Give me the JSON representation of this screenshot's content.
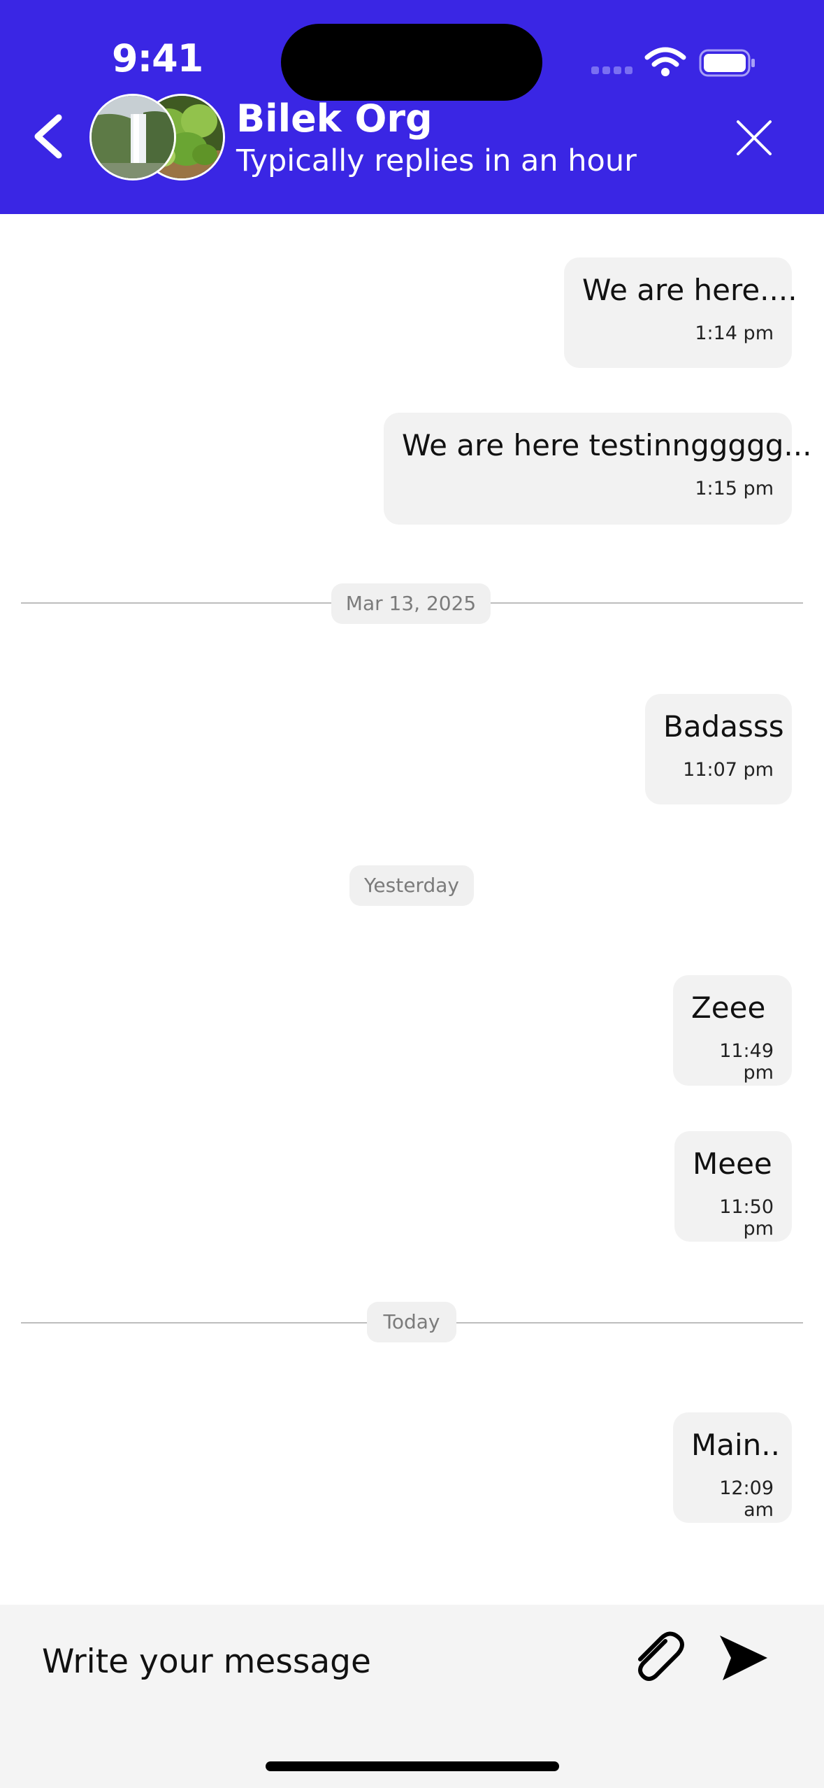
{
  "status_bar": {
    "time": "9:41"
  },
  "header": {
    "title": "Bilek Org",
    "subtitle": "Typically replies in an hour",
    "icons": {
      "back": "chevron-left-icon",
      "close": "close-icon"
    }
  },
  "messages": [
    {
      "text": "We are here....",
      "time": "1:14 pm"
    },
    {
      "text": "We are here testinnggggg...",
      "time": "1:15 pm"
    },
    {
      "text": "Badasss",
      "time": "11:07 pm"
    },
    {
      "text": "Zeee",
      "time": "11:49 pm"
    },
    {
      "text": "Meee",
      "time": "11:50 pm"
    },
    {
      "text": "Main..",
      "time": "12:09 am"
    }
  ],
  "dividers": [
    "Mar 13, 2025",
    "Yesterday",
    "Today"
  ],
  "composer": {
    "placeholder": "Write your message",
    "icons": {
      "attach": "paperclip-icon",
      "send": "send-icon"
    }
  },
  "colors": {
    "header_bg": "#3a26e4",
    "bubble_bg": "#f2f2f2",
    "composer_bg": "#f4f4f4"
  }
}
